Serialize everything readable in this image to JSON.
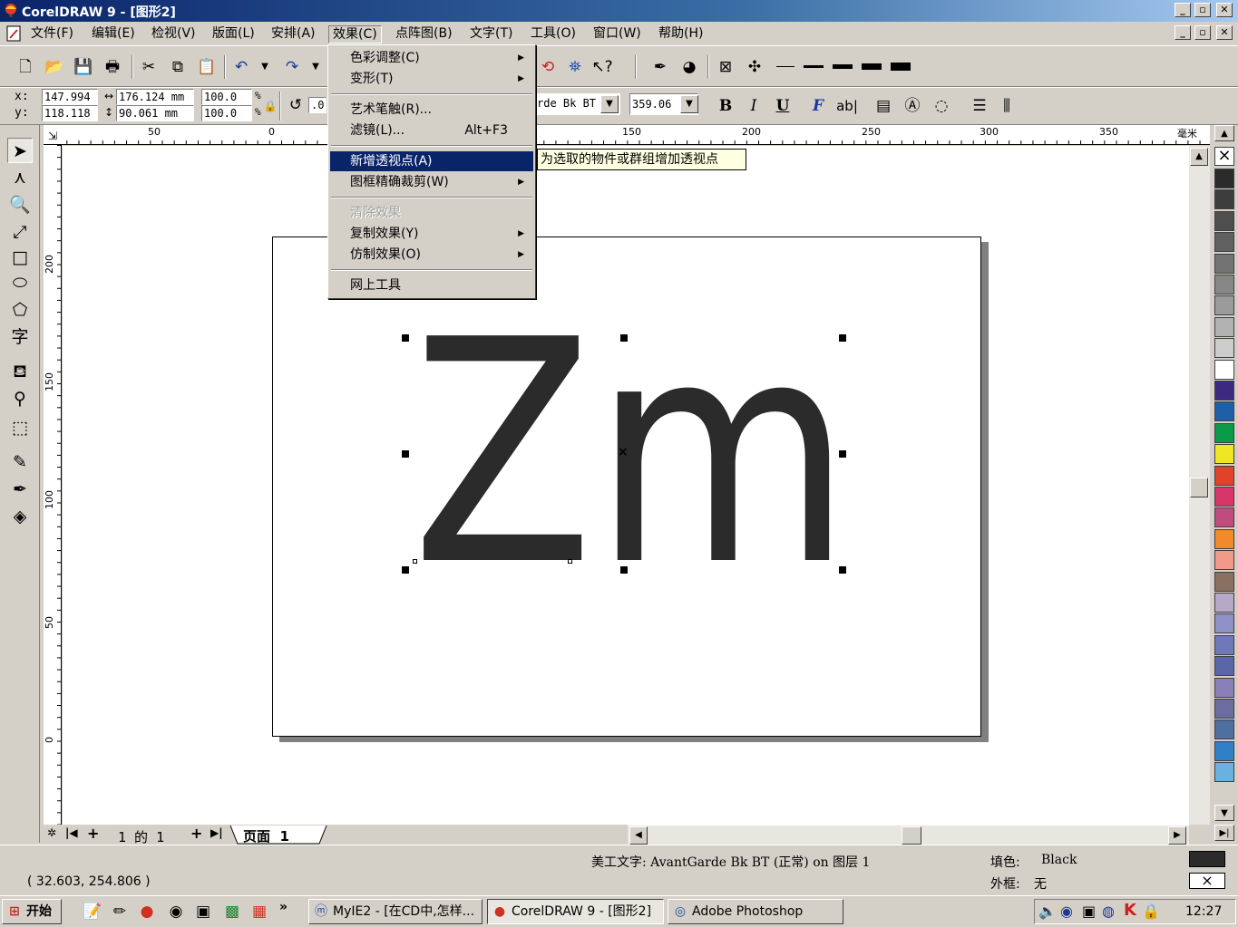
{
  "window": {
    "title": "CorelDRAW 9 - [图形2]",
    "controls": [
      "_",
      "▫",
      "✕"
    ]
  },
  "menubar": {
    "items": [
      "文件(F)",
      "编辑(E)",
      "检视(V)",
      "版面(L)",
      "安排(A)",
      "效果(C)",
      "点阵图(B)",
      "文字(T)",
      "工具(O)",
      "窗口(W)",
      "帮助(H)"
    ],
    "active": "效果(C)"
  },
  "effects_menu": {
    "items": [
      {
        "label": "色彩调整(C)",
        "submenu": true
      },
      {
        "label": "变形(T)",
        "submenu": true
      },
      {
        "label": "艺术笔触(R)..."
      },
      {
        "label": "滤镜(L)...",
        "shortcut": "Alt+F3"
      },
      {
        "label": "新增透视点(A)",
        "highlighted": true
      },
      {
        "label": "图框精确裁剪(W)",
        "submenu": true
      },
      {
        "label": "清除效果",
        "disabled": true
      },
      {
        "label": "复制效果(Y)",
        "submenu": true
      },
      {
        "label": "仿制效果(O)",
        "submenu": true
      },
      {
        "label": "网上工具"
      }
    ]
  },
  "tooltip": "为选取的物件或群组增加透视点",
  "property_bar": {
    "x_label": "x:",
    "y_label": "y:",
    "x": "147.994",
    "y": "118.118",
    "width": "176.124 mm",
    "height": "90.061 mm",
    "scale_x": "100.0",
    "scale_y": "100.0",
    "percent": "%",
    "rotation": ".0",
    "font_name": "rde Bk BT",
    "font_size": "359.06",
    "bold": "B",
    "italic": "I",
    "underline": "U",
    "abl": "ab|"
  },
  "ruler": {
    "h_labels": [
      "50",
      "0",
      "150",
      "200",
      "250",
      "300",
      "350"
    ],
    "unit": "毫米",
    "v_labels": [
      "200",
      "150",
      "100",
      "50",
      "0"
    ]
  },
  "canvas_text": "Zm",
  "page_nav": {
    "first": "|◀",
    "add_before": "+",
    "counter": "1 的 1",
    "add_after": "+",
    "last": "▶|",
    "tab": "页面  1"
  },
  "status": {
    "object_info": "美工文字: AvantGarde Bk BT (正常) on 图层 1",
    "coords": "( 32.603, 254.806 )",
    "fill_label": "填色:",
    "fill_value": "Black",
    "outline_label": "外框:",
    "outline_value": "无"
  },
  "taskbar": {
    "start": "开始",
    "more": "»",
    "buttons": [
      "MyIE2 - [在CD中,怎样...",
      "CorelDRAW 9 - [图形2]",
      "Adobe Photoshop"
    ],
    "time": "12:27"
  },
  "palette_colors": [
    "#2a2a2a",
    "#3c3c3c",
    "#4e4e4e",
    "#606060",
    "#737373",
    "#878787",
    "#9b9b9b",
    "#b2b2b2",
    "#cccccc",
    "#ffffff",
    "#3b2a80",
    "#1f5fa8",
    "#0a9a4a",
    "#f1e626",
    "#e2412a",
    "#d8356a",
    "#c14b7e",
    "#f08a2a",
    "#f19a8a",
    "#8a7060",
    "#b5a8c8",
    "#8f90c8",
    "#6f78b8",
    "#5a66a8",
    "#8a80b8",
    "#6c6ca0",
    "#4f6fa0",
    "#2f80c8",
    "#6ab0e0"
  ],
  "colors": {
    "title_start": "#0a246a",
    "title_end": "#a6caf0",
    "menu_highlight": "#0a246a",
    "glyph": "#2b2b2b",
    "tooltip_bg": "#ffffe1"
  }
}
